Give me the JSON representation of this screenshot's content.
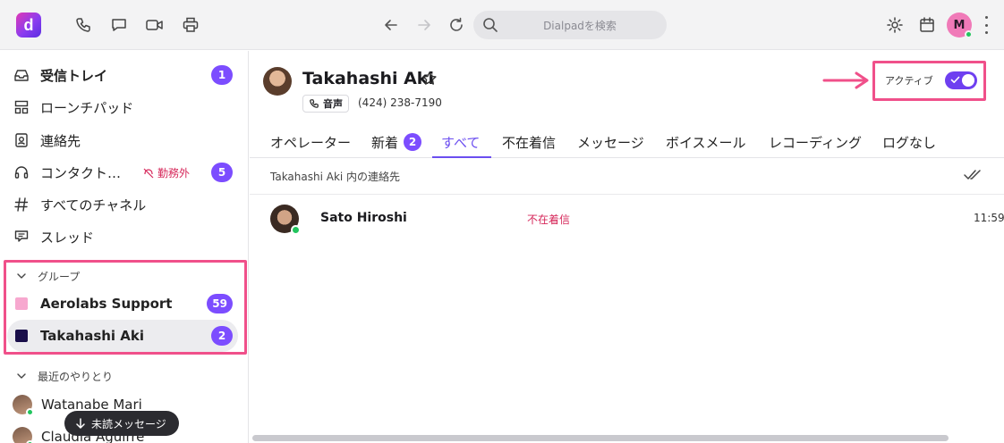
{
  "app": {
    "logo_letter": "d"
  },
  "topbar": {
    "search_placeholder": "Dialpadを検索",
    "user_initial": "M"
  },
  "sidebar": {
    "items": [
      {
        "label": "受信トレイ",
        "badge": "1"
      },
      {
        "label": "ローンチパッド"
      },
      {
        "label": "連絡先"
      },
      {
        "label": "コンタクト…",
        "status": "勤務外",
        "badge": "5"
      },
      {
        "label": "すべてのチャネル"
      },
      {
        "label": "スレッド"
      }
    ],
    "groups_heading": "グループ",
    "groups": [
      {
        "label": "Aerolabs Support",
        "badge": "59",
        "color": "#f7a8cf"
      },
      {
        "label": "Takahashi Aki",
        "badge": "2",
        "color": "#1a0f4a"
      }
    ],
    "recent_heading": "最近のやりとり",
    "recent": [
      {
        "label": "Watanabe Mari"
      },
      {
        "label": "Claudia Aguirre"
      }
    ],
    "unread_pill": "未読メッセージ"
  },
  "header": {
    "name": "Takahashi Aki",
    "voice_chip": "音声",
    "phone": "(424) 238-7190",
    "active_label": "アクティブ"
  },
  "tabs": [
    {
      "label": "オペレーター"
    },
    {
      "label": "新着",
      "badge": "2"
    },
    {
      "label": "すべて"
    },
    {
      "label": "不在着信"
    },
    {
      "label": "メッセージ"
    },
    {
      "label": "ボイスメール"
    },
    {
      "label": "レコーディング"
    },
    {
      "label": "ログなし"
    }
  ],
  "list": {
    "subheading": "Takahashi Aki 内の連絡先",
    "rows": [
      {
        "name": "Sato Hiroshi",
        "status": "不在着信",
        "time": "11:59"
      }
    ]
  },
  "colors": {
    "accent": "#7c4dff",
    "highlight": "#f0508a",
    "missed": "#d6275a",
    "online": "#22c55e"
  }
}
